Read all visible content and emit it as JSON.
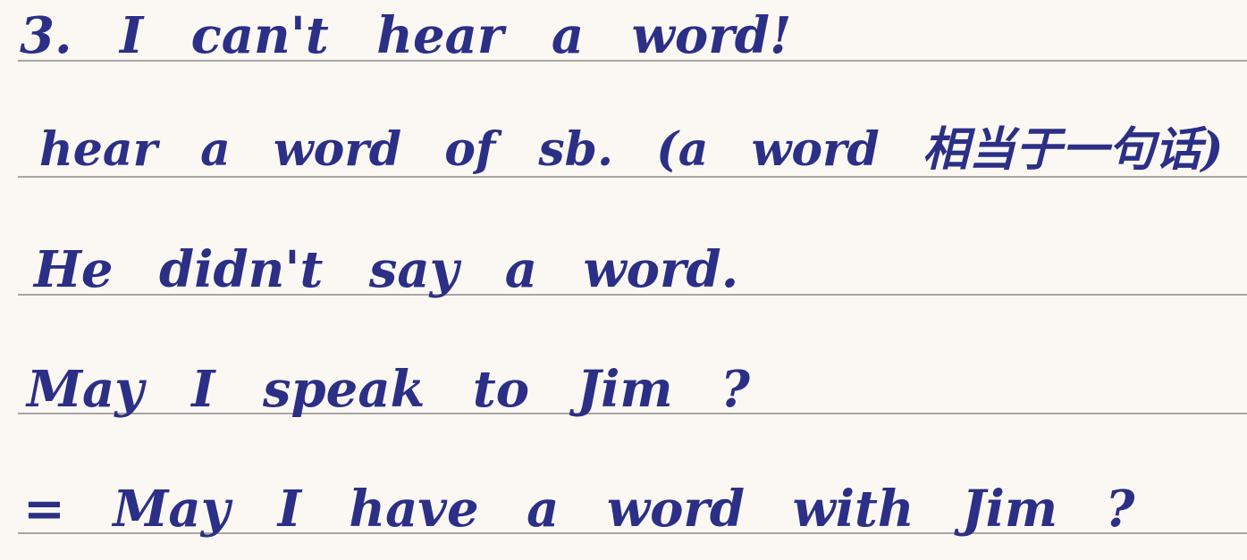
{
  "notes": {
    "lines": [
      {
        "text": "3. I can't hear a word!"
      },
      {
        "text": "hear a word of sb. (a word 相当于一句话)"
      },
      {
        "text": "He didn't say a word."
      },
      {
        "text": "May I speak to Jim ?"
      },
      {
        "text": "= May I have a word with Jim ?"
      }
    ]
  },
  "colors": {
    "ink": "#2b2f86",
    "paper": "#fbf8f3",
    "rule": "#a8a6a4"
  }
}
